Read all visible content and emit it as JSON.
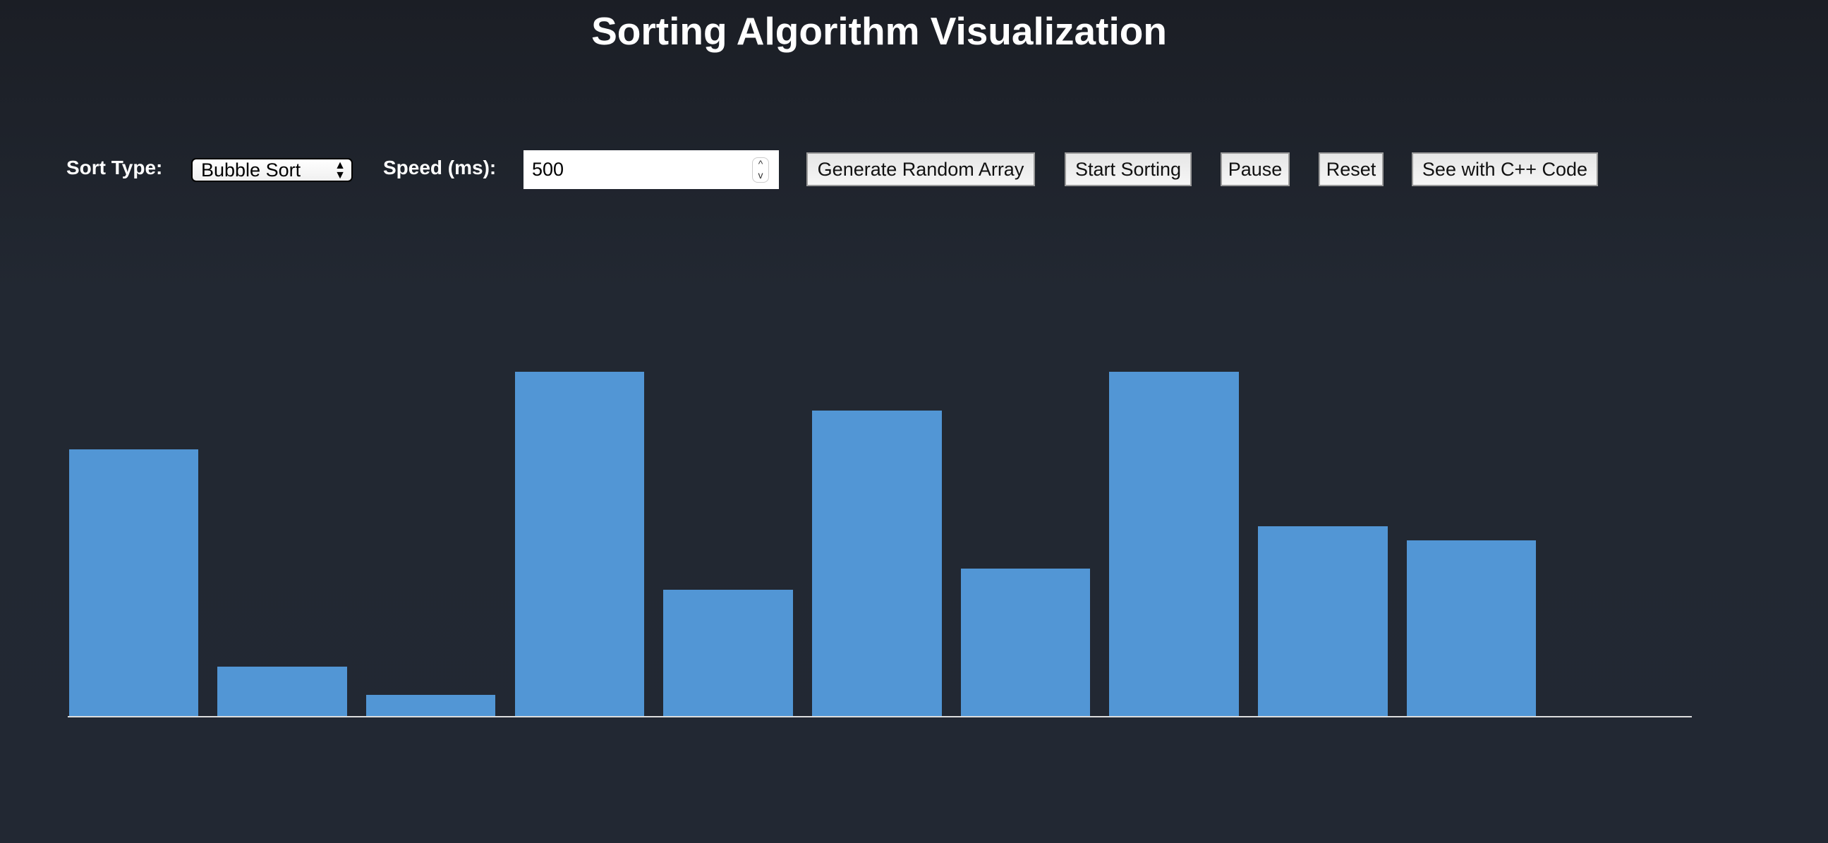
{
  "title": "Sorting Algorithm Visualization",
  "controls": {
    "sort_type_label": "Sort Type:",
    "sort_type_value": "Bubble Sort",
    "speed_label": "Speed (ms):",
    "speed_value": "500",
    "buttons": {
      "generate": "Generate Random Array",
      "start": "Start Sorting",
      "pause": "Pause",
      "reset": "Reset",
      "cpp": "See with C++ Code"
    }
  },
  "colors": {
    "bar": "#5296d5",
    "background": "#222832"
  },
  "chart_data": {
    "type": "bar",
    "values": [
      76,
      14,
      6,
      98,
      36,
      87,
      42,
      98,
      54,
      50
    ],
    "ylim": [
      0,
      100
    ]
  }
}
